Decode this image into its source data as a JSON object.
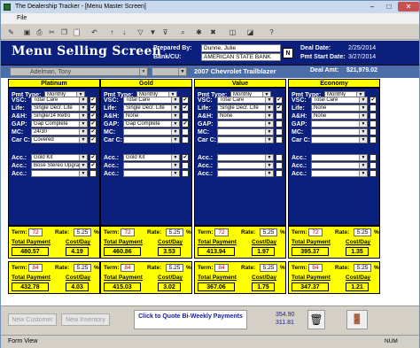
{
  "window": {
    "title": "The Dealership Tracker - [Menu Master Screen]",
    "min_label": "–",
    "max_label": "□",
    "close_label": "✕"
  },
  "menubar": {
    "file": "File"
  },
  "toolbar_icons": [
    "form-design-icon",
    "save-icon",
    "print-icon",
    "cut-icon",
    "copy-icon",
    "paste-icon",
    "undo-icon",
    "sort-ascending-icon",
    "sort-descending-icon",
    "filter-icon",
    "filter-form-icon",
    "apply-filter-icon",
    "find-icon",
    "new-record-icon",
    "delete-record-icon",
    "database-icon",
    "new-object-icon",
    "help-icon"
  ],
  "header": {
    "screen_title": "Menu Selling Screen",
    "prepared_by_label": "Prepared By:",
    "prepared_by": "Dunne, Julie",
    "bank_label": "Bank/CU:",
    "bank": "AMERICAN STATE BANK",
    "n_label": "N",
    "deal_date_label": "Deal Date:",
    "deal_date": "2/25/2014",
    "pmt_start_label": "Pmt Start Date:",
    "pmt_start": "3/27/2014"
  },
  "subheader": {
    "salesperson": "Adelman, Tony",
    "vehicle": "2007 Chevrolet Trailblazer",
    "deal_amt_label": "Deal Amt:",
    "deal_amt": "$21,979.02"
  },
  "labels": {
    "pmt_type": "Pmt Type:",
    "vsc": "VSC:",
    "life": "Life:",
    "ah": "A&H:",
    "gap": "GAP:",
    "mc": "MC:",
    "carc": "Car C:",
    "acc": "Acc.:",
    "term": "Term:",
    "rate": "Rate:",
    "pct": "%",
    "total_payment": "Total Payment",
    "cost_day": "Cost/Day"
  },
  "columns": [
    {
      "name": "Platinum",
      "pmt_type": "Monthly",
      "vsc": "Total Care",
      "life": "Single Decr. Life",
      "ah": "Single/14 Retro",
      "gap": "Gap Complete",
      "mc": "24/30",
      "carc": "Covered",
      "acc1": "Gold Kit",
      "acc2": "Bose Stereo Upgrade",
      "acc3": "",
      "checks": {
        "vsc": true,
        "life": true,
        "ah": true,
        "gap": true,
        "mc": true,
        "carc": true,
        "acc1": true,
        "acc2": true,
        "acc3": false
      },
      "term1": "72",
      "rate1": "5.25",
      "total1": "480.57",
      "cost1": "4.19",
      "term2": "84",
      "rate2": "5.25",
      "total2": "432.78",
      "cost2": "4.03"
    },
    {
      "name": "Gold",
      "pmt_type": "Monthly",
      "vsc": "Total Care",
      "life": "Single Decr. Life",
      "ah": "None",
      "gap": "Gap Complete",
      "mc": "",
      "carc": "",
      "acc1": "Gold Kit",
      "acc2": "",
      "acc3": "",
      "checks": {
        "vsc": true,
        "life": true,
        "ah": false,
        "gap": true,
        "mc": false,
        "carc": false,
        "acc1": true,
        "acc2": false,
        "acc3": false
      },
      "term1": "72",
      "rate1": "5.25",
      "total1": "460.86",
      "cost1": "3.53",
      "term2": "84",
      "rate2": "5.25",
      "total2": "415.03",
      "cost2": "3.02"
    },
    {
      "name": "Value",
      "pmt_type": "Monthly",
      "vsc": "Total Care",
      "life": "Single Decr. Life",
      "ah": "None",
      "gap": "",
      "mc": "",
      "carc": "",
      "acc1": "",
      "acc2": "",
      "acc3": "",
      "checks": {
        "vsc": true,
        "life": true,
        "ah": false,
        "gap": false,
        "mc": false,
        "carc": false,
        "acc1": false,
        "acc2": false,
        "acc3": false
      },
      "term1": "72",
      "rate1": "5.25",
      "total1": "413.94",
      "cost1": "1.97",
      "term2": "84",
      "rate2": "5.25",
      "total2": "367.06",
      "cost2": "1.75"
    },
    {
      "name": "Economy",
      "pmt_type": "Monthly",
      "vsc": "Total Care",
      "life": "None",
      "ah": "None",
      "gap": "",
      "mc": "",
      "carc": "",
      "acc1": "",
      "acc2": "",
      "acc3": "",
      "checks": {
        "vsc": true,
        "life": false,
        "ah": false,
        "gap": false,
        "mc": false,
        "carc": false,
        "acc1": false,
        "acc2": false,
        "acc3": false
      },
      "term1": "72",
      "rate1": "5.25",
      "total1": "395.37",
      "cost1": "1.35",
      "term2": "84",
      "rate2": "5.25",
      "total2": "347.37",
      "cost2": "1.21"
    }
  ],
  "bottom": {
    "new_customer": "New Customer",
    "new_inventory": "New Inventory",
    "biweekly": "Click to Quote Bi-Weekly Payments",
    "num_a": "354.90",
    "num_b": "311.81"
  },
  "status": {
    "view": "Form View",
    "numlock": "NUM"
  },
  "colors": {
    "navy": "#0b1f7d",
    "yellow": "#ffff00",
    "red": "#d00000",
    "subheader": "#4c6ea8"
  }
}
